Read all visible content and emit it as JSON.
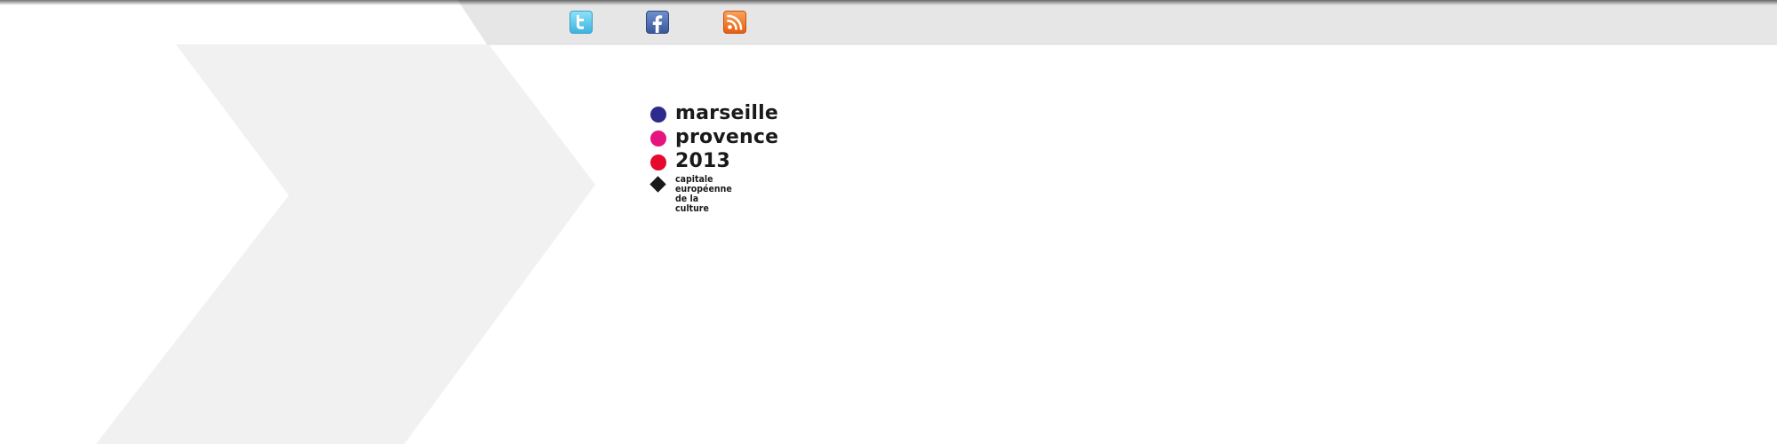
{
  "social": {
    "items": [
      {
        "name": "twitter",
        "icon": "twitter-icon",
        "color": "#3cb4df"
      },
      {
        "name": "facebook",
        "icon": "facebook-icon",
        "color": "#3b5998"
      },
      {
        "name": "rss",
        "icon": "rss-icon",
        "color": "#e65f12"
      }
    ]
  },
  "logo": {
    "line1": "marseille",
    "line2": "provence",
    "line3": "2013",
    "tagline_line1": "capitale européenne",
    "tagline_line2": "de la culture",
    "dot_colors": [
      "#2e2a8c",
      "#e5147f",
      "#e4092d"
    ],
    "diamond_color": "#1a1a1a"
  },
  "theme": {
    "top_bar_color": "#e6e6e6",
    "chevron_color": "#f1f1f1",
    "background": "#ffffff"
  }
}
